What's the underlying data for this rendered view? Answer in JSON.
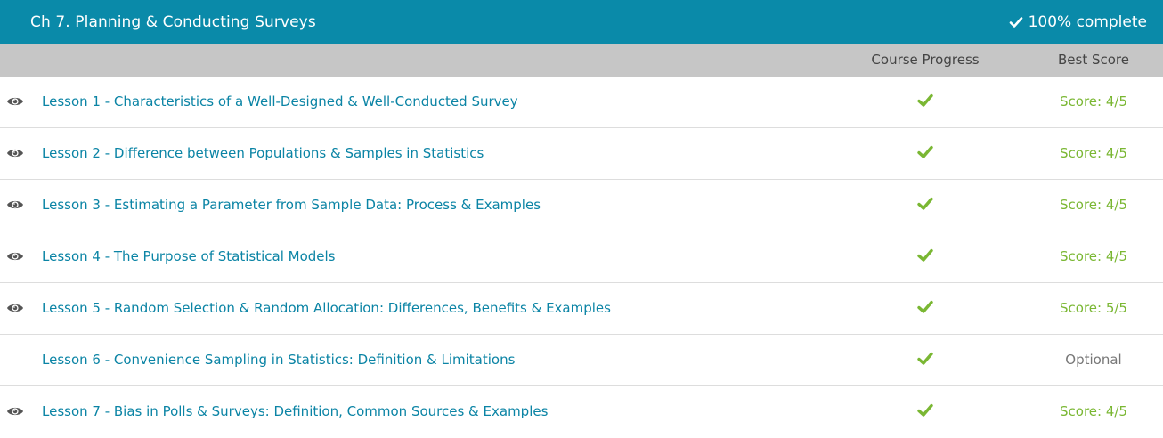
{
  "chapter": {
    "title": "Ch 7. Planning & Conducting Surveys",
    "completion_text": "100% complete",
    "completion_icon": "check-icon"
  },
  "columns": {
    "course_progress": "Course Progress",
    "best_score": "Best Score"
  },
  "colors": {
    "header_bg": "#0a8aa9",
    "column_header_bg": "#c6c6c6",
    "link": "#0b84a5",
    "score_green": "#7ab733",
    "optional_gray": "#777777",
    "eye_icon": "#555555"
  },
  "lessons": [
    {
      "label": "Lesson 1 - Characteristics of a Well-Designed & Well-Conducted Survey",
      "score": "Score: 4/5",
      "viewed": true,
      "completed": true
    },
    {
      "label": "Lesson 2 - Difference between Populations & Samples in Statistics",
      "score": "Score: 4/5",
      "viewed": true,
      "completed": true
    },
    {
      "label": "Lesson 3 - Estimating a Parameter from Sample Data: Process & Examples",
      "score": "Score: 4/5",
      "viewed": true,
      "completed": true
    },
    {
      "label": "Lesson 4 - The Purpose of Statistical Models",
      "score": "Score: 4/5",
      "viewed": true,
      "completed": true
    },
    {
      "label": "Lesson 5 - Random Selection & Random Allocation: Differences, Benefits & Examples",
      "score": "Score: 5/5",
      "viewed": true,
      "completed": true
    },
    {
      "label": "Lesson 6 - Convenience Sampling in Statistics: Definition & Limitations",
      "score": "Optional",
      "viewed": false,
      "completed": true
    },
    {
      "label": "Lesson 7 - Bias in Polls & Surveys: Definition, Common Sources & Examples",
      "score": "Score: 4/5",
      "viewed": true,
      "completed": true
    }
  ]
}
